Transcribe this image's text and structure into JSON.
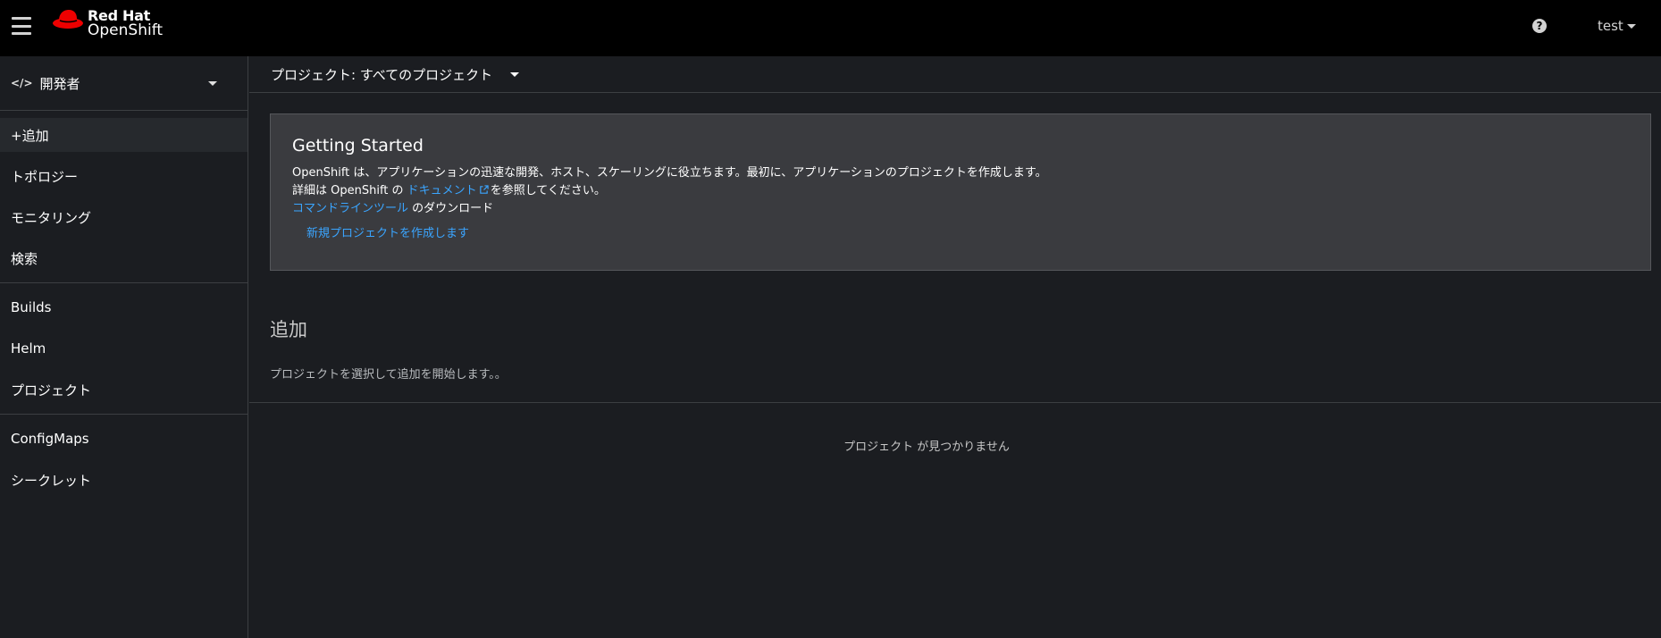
{
  "masthead": {
    "brand_line1": "Red Hat",
    "brand_line2": "OpenShift",
    "help_icon": "question-circle-icon",
    "help_glyph": "?",
    "user": "test"
  },
  "sidebar": {
    "perspective_icon": "</>",
    "perspective": "開発者",
    "groups": [
      [
        "+追加",
        "トポロジー",
        "モニタリング",
        "検索"
      ],
      [
        "Builds",
        "Helm",
        "プロジェクト"
      ],
      [
        "ConfigMaps",
        "シークレット"
      ]
    ]
  },
  "project_bar": {
    "label": "プロジェクト: すべてのプロジェクト"
  },
  "getting_started": {
    "title": "Getting Started",
    "line1": "OpenShift は、アプリケーションの迅速な開発、ホスト、スケーリングに役立ちます。最初に、アプリケーションのプロジェクトを作成します。",
    "line2_prefix": "詳細は OpenShift の ",
    "line2_link": "ドキュメント",
    "line2_suffix": "を参照してください。",
    "line3_link": "コマンドラインツール",
    "line3_suffix": " のダウンロード",
    "create_link": "新規プロジェクトを作成します"
  },
  "add": {
    "title": "追加",
    "description": "プロジェクトを選択して追加を開始します。。"
  },
  "empty": {
    "message": "プロジェクト が見つかりません"
  },
  "colors": {
    "link": "#3aa5ff",
    "redhat_red": "#ee0000",
    "background": "#1b1d21"
  }
}
